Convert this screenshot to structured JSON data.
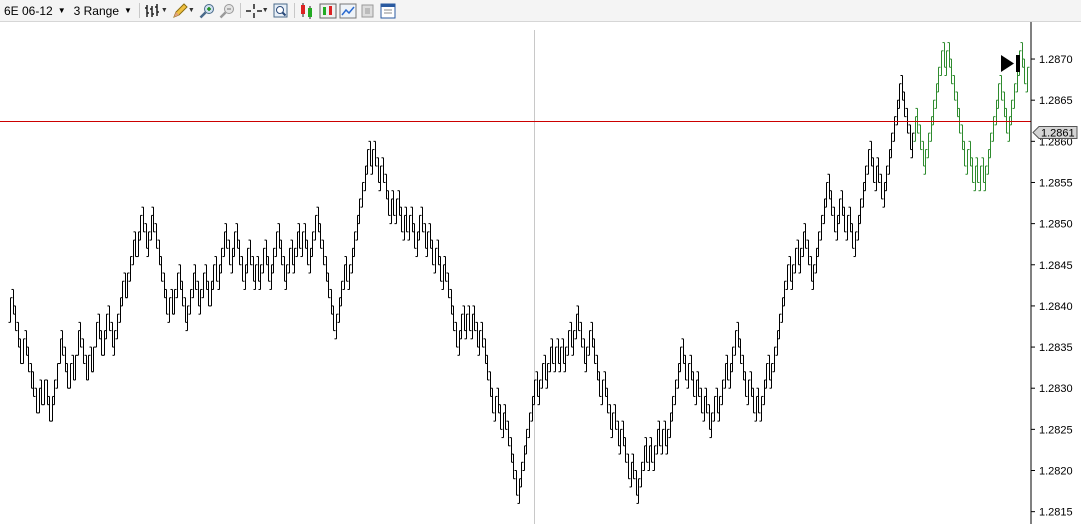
{
  "toolbar": {
    "instrument": "6E 06-12",
    "period": "3 Range",
    "icons": [
      "bar-style-icon",
      "pencil-icon",
      "zoom-in-icon",
      "zoom-out-icon",
      "crosshair-icon",
      "data-box-icon",
      "indicators-icon",
      "strategies-icon",
      "chart-trader-icon",
      "properties-icon",
      "window-icon"
    ]
  },
  "colors": {
    "up_bars": "#2e8b2e",
    "bars": "#000000",
    "price_line": "#cc0000",
    "marker_bg": "#d4d4d4"
  },
  "chart_data": {
    "type": "range_bars",
    "y_ticks": [
      "1.2870",
      "1.2865",
      "1.2860",
      "1.2855",
      "1.2850",
      "1.2845",
      "1.2840",
      "1.2835",
      "1.2830",
      "1.2825",
      "1.2820",
      "1.2815"
    ],
    "ylim": [
      1.28135,
      1.28745
    ],
    "current_price": "1.2861",
    "current_price_value": 1.28625,
    "x_gridline_bar": 201,
    "bar_range": 0.0003,
    "closes": [
      1.2841,
      1.2839,
      1.2837,
      1.2835,
      1.2833,
      1.2836,
      1.2834,
      1.2832,
      1.283,
      1.2829,
      1.2827,
      1.283,
      1.2828,
      1.2831,
      1.2828,
      1.2826,
      1.2829,
      1.2831,
      1.2833,
      1.2836,
      1.2834,
      1.2832,
      1.283,
      1.2833,
      1.2831,
      1.2834,
      1.2837,
      1.2835,
      1.2833,
      1.2831,
      1.2834,
      1.2832,
      1.2835,
      1.2838,
      1.2836,
      1.2834,
      1.2837,
      1.2839,
      1.2837,
      1.2835,
      1.2837,
      1.2839,
      1.2841,
      1.2843,
      1.2841,
      1.2844,
      1.2846,
      1.2848,
      1.2846,
      1.2849,
      1.2851,
      1.2849,
      1.2847,
      1.2849,
      1.2851,
      1.2849,
      1.2847,
      1.2845,
      1.2843,
      1.2841,
      1.2839,
      1.2841,
      1.2839,
      1.2842,
      1.2844,
      1.2842,
      1.284,
      1.2838,
      1.284,
      1.2842,
      1.2844,
      1.2842,
      1.284,
      1.2842,
      1.2844,
      1.2842,
      1.284,
      1.2843,
      1.2845,
      1.2843,
      1.2845,
      1.2847,
      1.2849,
      1.2847,
      1.2845,
      1.2847,
      1.2849,
      1.2847,
      1.2845,
      1.2843,
      1.2845,
      1.2847,
      1.2845,
      1.2843,
      1.2845,
      1.2843,
      1.2845,
      1.2847,
      1.2845,
      1.2843,
      1.2845,
      1.2847,
      1.2849,
      1.2847,
      1.2845,
      1.2843,
      1.2845,
      1.2847,
      1.2845,
      1.2847,
      1.2849,
      1.2847,
      1.2849,
      1.2847,
      1.2845,
      1.2847,
      1.2849,
      1.2851,
      1.2849,
      1.2847,
      1.2845,
      1.2843,
      1.2841,
      1.2839,
      1.2837,
      1.2839,
      1.2841,
      1.2843,
      1.2845,
      1.2843,
      1.2845,
      1.2847,
      1.2849,
      1.2851,
      1.2853,
      1.2855,
      1.2857,
      1.2859,
      1.2857,
      1.2859,
      1.2857,
      1.2855,
      1.2857,
      1.2855,
      1.2853,
      1.2851,
      1.2853,
      1.2851,
      1.2853,
      1.2851,
      1.2849,
      1.2851,
      1.2849,
      1.2851,
      1.2849,
      1.2847,
      1.2849,
      1.2851,
      1.2849,
      1.2847,
      1.2849,
      1.2847,
      1.2845,
      1.2847,
      1.2845,
      1.2843,
      1.2845,
      1.2843,
      1.2841,
      1.2839,
      1.2837,
      1.2835,
      1.2837,
      1.2839,
      1.2837,
      1.2839,
      1.2837,
      1.2839,
      1.2837,
      1.2835,
      1.2837,
      1.2835,
      1.2833,
      1.2831,
      1.2829,
      1.2827,
      1.2829,
      1.2827,
      1.2825,
      1.2827,
      1.2825,
      1.2823,
      1.2821,
      1.2819,
      1.2817,
      1.2819,
      1.2821,
      1.2823,
      1.2825,
      1.2827,
      1.2829,
      1.2831,
      1.2829,
      1.2831,
      1.2833,
      1.2831,
      1.2833,
      1.2835,
      1.2833,
      1.2835,
      1.2833,
      1.2835,
      1.2833,
      1.2835,
      1.2837,
      1.2835,
      1.2837,
      1.2839,
      1.2837,
      1.2835,
      1.2833,
      1.2835,
      1.2837,
      1.2835,
      1.2833,
      1.2831,
      1.2829,
      1.2831,
      1.2829,
      1.2827,
      1.2825,
      1.2827,
      1.2825,
      1.2823,
      1.2825,
      1.2823,
      1.2821,
      1.2819,
      1.2821,
      1.2819,
      1.2817,
      1.2819,
      1.2821,
      1.2823,
      1.2821,
      1.2823,
      1.2821,
      1.2823,
      1.2825,
      1.2823,
      1.2825,
      1.2823,
      1.2825,
      1.2827,
      1.2829,
      1.2831,
      1.2833,
      1.2835,
      1.2833,
      1.2831,
      1.2833,
      1.2831,
      1.2829,
      1.2831,
      1.2829,
      1.2827,
      1.2829,
      1.2827,
      1.2825,
      1.2827,
      1.2829,
      1.2827,
      1.2829,
      1.2831,
      1.2833,
      1.2831,
      1.2833,
      1.2835,
      1.2837,
      1.2835,
      1.2833,
      1.2831,
      1.2829,
      1.2831,
      1.2829,
      1.2827,
      1.2829,
      1.2827,
      1.2829,
      1.2831,
      1.2833,
      1.2831,
      1.2833,
      1.2835,
      1.2837,
      1.2839,
      1.2841,
      1.2843,
      1.2845,
      1.2843,
      1.2845,
      1.2847,
      1.2845,
      1.2847,
      1.2849,
      1.2847,
      1.2845,
      1.2843,
      1.2845,
      1.2847,
      1.2849,
      1.2851,
      1.2853,
      1.2855,
      1.2853,
      1.2851,
      1.2849,
      1.2851,
      1.2853,
      1.2851,
      1.2849,
      1.2851,
      1.2849,
      1.2847,
      1.2849,
      1.2851,
      1.2853,
      1.2855,
      1.2857,
      1.2859,
      1.2857,
      1.2855,
      1.2857,
      1.2855,
      1.2853,
      1.2855,
      1.2857,
      1.2859,
      1.2861,
      1.2863,
      1.2865,
      1.2867,
      1.2865,
      1.2863,
      1.2861,
      1.2859,
      1.2861,
      1.2863,
      1.2861,
      1.2859,
      1.2857,
      1.2859,
      1.2861,
      1.2863,
      1.2865,
      1.2867,
      1.2869,
      1.2871,
      1.2869,
      1.2871,
      1.2869,
      1.2867,
      1.2865,
      1.2863,
      1.2861,
      1.2859,
      1.2857,
      1.2859,
      1.2857,
      1.2855,
      1.2857,
      1.2855,
      1.2857,
      1.2855,
      1.2857,
      1.2859,
      1.2861,
      1.2863,
      1.2865,
      1.2867,
      1.2865,
      1.2863,
      1.2861,
      1.2863,
      1.2865,
      1.2867,
      1.2869,
      1.2871,
      1.2869,
      1.2867,
      1.2869
    ]
  }
}
